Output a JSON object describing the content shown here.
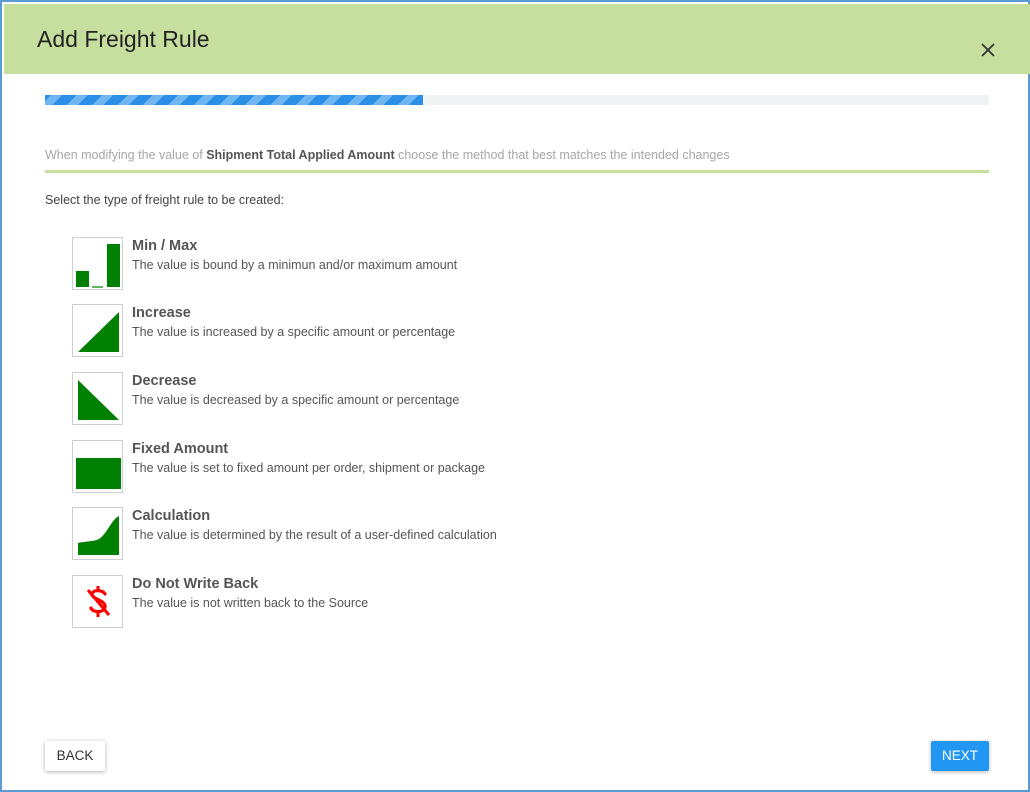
{
  "dialog": {
    "title": "Add Freight Rule",
    "close_icon": "close-icon"
  },
  "progress": {
    "fraction": 0.4
  },
  "instruction": {
    "prefix": "When modifying the value of ",
    "field": "Shipment Total Applied Amount",
    "suffix": " choose the method that best matches the intended changes"
  },
  "select_label": "Select the type of freight rule to be created:",
  "rules": [
    {
      "title": "Min / Max",
      "desc": "The value is bound by a minimun and/or maximum amount",
      "icon": "min-max-icon"
    },
    {
      "title": "Increase",
      "desc": "The value is increased by a specific amount or percentage",
      "icon": "increase-icon"
    },
    {
      "title": "Decrease",
      "desc": "The value is decreased by a specific amount or percentage",
      "icon": "decrease-icon"
    },
    {
      "title": "Fixed Amount",
      "desc": "The value is set to fixed amount per order, shipment or package",
      "icon": "fixed-amount-icon"
    },
    {
      "title": "Calculation",
      "desc": "The value is determined by the result of a user-defined calculation",
      "icon": "calculation-icon"
    },
    {
      "title": "Do Not Write Back",
      "desc": "The value is not written back to the Source",
      "icon": "no-dollar-icon"
    }
  ],
  "buttons": {
    "back": "BACK",
    "next": "NEXT"
  },
  "colors": {
    "header": "#c6df9f",
    "accent": "#2196f3",
    "icon_green": "#008000",
    "icon_red": "#ff0000"
  }
}
